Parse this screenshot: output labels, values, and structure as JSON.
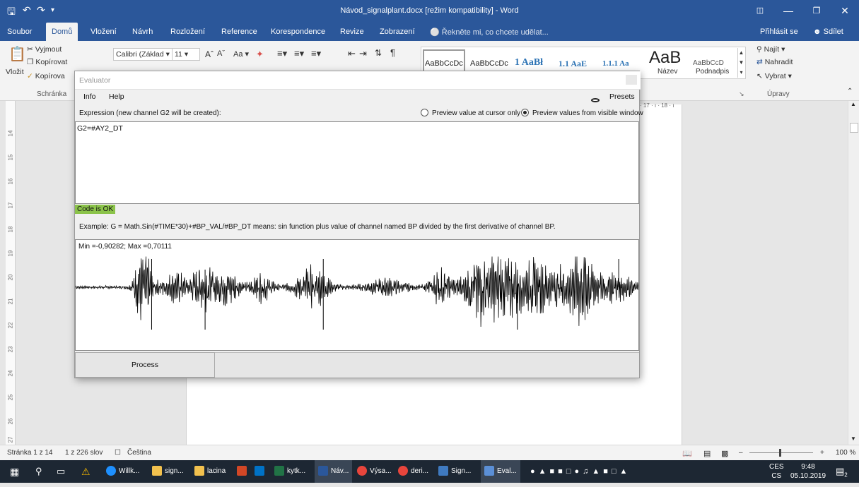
{
  "window": {
    "title": "Návod_signalplant.docx [režim kompatibility] - Word"
  },
  "ribbon_tabs": [
    "Soubor",
    "Domů",
    "Vložení",
    "Návrh",
    "Rozložení",
    "Reference",
    "Korespondence",
    "Revize",
    "Zobrazení"
  ],
  "tell_me": "Řekněte mi, co chcete udělat...",
  "sign_in": "Přihlásit se",
  "share": "Sdílet",
  "clipboard": {
    "paste": "Vložit",
    "cut": "Vyjmout",
    "copy": "Kopírovat",
    "format_painter": "Kopírova",
    "group": "Schránka"
  },
  "font": {
    "name": "Calibri (Základ",
    "size": "11"
  },
  "styles": [
    {
      "label": "AaBbCcDc",
      "name": ""
    },
    {
      "label": "AaBbCcDc",
      "name": ""
    },
    {
      "label": "1 AaBł",
      "name": ""
    },
    {
      "label": "1.1 AaE",
      "name": ""
    },
    {
      "label": "1.1.1 Aa",
      "name": ""
    },
    {
      "label": "AaB",
      "name": "Název"
    },
    {
      "label": "AaBbCcD",
      "name": "Podnadpis"
    }
  ],
  "editing": {
    "find": "Najít",
    "replace": "Nahradit",
    "select": "Vybrat",
    "group": "Úpravy"
  },
  "ruler": {
    "vertical": [
      "14",
      "15",
      "16",
      "17",
      "18",
      "19",
      "20",
      "21",
      "22",
      "23",
      "24",
      "25",
      "26",
      "27"
    ],
    "horizontal_fragment": "· 17 · ı · 18 · ı"
  },
  "status": {
    "page": "Stránka 1 z 14",
    "words": "1 z 226 slov",
    "language": "Čeština",
    "zoom": "100 %"
  },
  "taskbar": {
    "items": [
      "Willk...",
      "sign...",
      "lacina",
      "kytk...",
      "Náv...",
      "Výsa...",
      "deri...",
      "Sign...",
      "Eval..."
    ],
    "lang": "CES",
    "lang2": "CS",
    "time": "9:48",
    "date": "05.10.2019",
    "notif_count": "2"
  },
  "evaluator": {
    "title": "Evaluator",
    "menu": [
      "Info",
      "Help"
    ],
    "presets": "Presets",
    "expression_label": "Expression (new channel G2 will be created):",
    "radio_cursor": "Preview value at cursor only",
    "radio_visible": "Preview values from visible window",
    "radio_selected": "visible",
    "expression": "G2=#AY2_DT",
    "status": "Code is OK",
    "example": "Example:  G = Math.Sin(#TIME*30)+#BP_VAL/#BP_DT  means: sin function plus value of channel named BP divided  by the first derivative of channel BP.",
    "minmax": "Min =-0,90282; Max =0,70111",
    "process_label": "Process",
    "colors": {
      "ok": "#8bc34a",
      "accent": "#2b579a"
    }
  },
  "chart_data": {
    "type": "line",
    "title": "",
    "xlabel": "",
    "ylabel": "",
    "y_min": -0.90282,
    "y_max": 0.70111,
    "grid": false,
    "bursts": [
      {
        "at": 0.12,
        "amp": 0.95,
        "width": 0.015
      },
      {
        "at": 0.18,
        "amp": 0.35,
        "width": 0.03
      },
      {
        "at": 0.23,
        "amp": 0.55,
        "width": 0.02
      },
      {
        "at": 0.27,
        "amp": 0.5,
        "width": 0.02
      },
      {
        "at": 0.33,
        "amp": 0.35,
        "width": 0.02
      },
      {
        "at": 0.42,
        "amp": 0.5,
        "width": 0.03
      },
      {
        "at": 0.55,
        "amp": 0.2,
        "width": 0.04
      },
      {
        "at": 0.65,
        "amp": 0.45,
        "width": 0.02
      },
      {
        "at": 0.72,
        "amp": 0.9,
        "width": 0.03
      },
      {
        "at": 0.77,
        "amp": 0.8,
        "width": 0.03
      },
      {
        "at": 0.82,
        "amp": 0.7,
        "width": 0.02
      },
      {
        "at": 0.86,
        "amp": 0.45,
        "width": 0.02
      },
      {
        "at": 0.9,
        "amp": 0.95,
        "width": 0.025
      },
      {
        "at": 0.96,
        "amp": 0.4,
        "width": 0.03
      }
    ]
  }
}
